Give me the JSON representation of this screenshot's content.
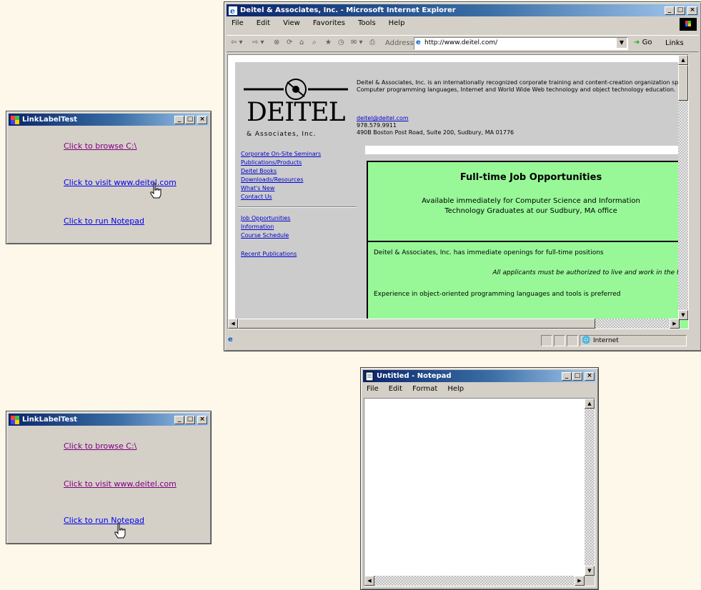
{
  "linklabel_top": {
    "title": "LinkLabelTest",
    "links": [
      "Click to browse C:\\",
      "Click to visit www.deitel.com",
      "Click to run Notepad"
    ]
  },
  "linklabel_bottom": {
    "title": "LinkLabelTest",
    "links": [
      "Click to browse C:\\",
      "Click to visit www.deitel.com",
      "Click to run Notepad"
    ]
  },
  "browser": {
    "title": "Deitel & Associates, Inc. - Microsoft Internet Explorer",
    "menu": [
      "File",
      "Edit",
      "View",
      "Favorites",
      "Tools",
      "Help"
    ],
    "address": "http://www.deitel.com/",
    "go_label": "Go",
    "links_label": "Links",
    "logo_word": "DEITEL",
    "logo_sub": "& Associates, Inc.",
    "intro_line1": "Deitel & Associates, Inc. is an internationally recognized corporate training and content-creation organization specializing in",
    "intro_line2": "Computer programming languages, Internet and World Wide Web technology and object technology education.",
    "contact_link": "deitel@deitel.com",
    "contact_line": "978.579.9911",
    "contact_line2": "490B Boston Post Road, Suite 200, Sudbury, MA 01776",
    "nav1": [
      "Corporate On-Site Seminars",
      "Publications/Products",
      "Deitel Books",
      "Downloads/Resources",
      "What's New",
      "Contact Us"
    ],
    "nav2": [
      "Job Opportunities",
      "Information",
      "Course Schedule"
    ],
    "nav3": [
      "Recent Publications"
    ],
    "job_heading": "Full-time Job Opportunities",
    "job_text1": "Available immediately for Computer Science and Information",
    "job_text2": "Technology Graduates at our Sudbury, MA office",
    "job_text3": "Deitel & Associates, Inc. has immediate openings for full-time positions",
    "job_text4": "All applicants must be authorized to live and work in the U.S.",
    "job_text5": "Experience in object-oriented programming languages and tools is preferred",
    "status_zone": "Internet"
  },
  "notepad": {
    "title": "Untitled - Notepad",
    "menu": [
      "File",
      "Edit",
      "Format",
      "Help"
    ],
    "content": ""
  },
  "colors": {
    "link": "#0000ee",
    "visited": "#800080",
    "job_box": "#98f898",
    "window_bg": "#d4d0c8",
    "page_bg": "#fdf8ea"
  }
}
